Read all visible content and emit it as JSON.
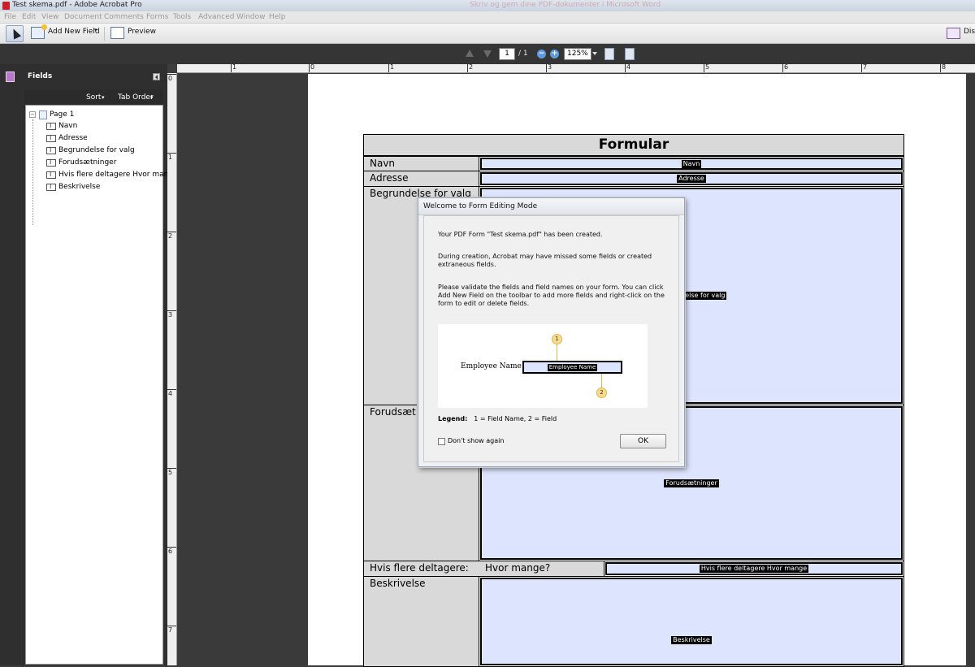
{
  "window": {
    "title": "Test skema.pdf - Adobe Acrobat Pro",
    "ghost_title": "Skriv og gem dine PDF-dokumenter i Microsoft Word"
  },
  "menu": [
    "File",
    "Edit",
    "View",
    "Document",
    "Comments",
    "Forms",
    "Tools",
    "Advanced",
    "Window",
    "Help"
  ],
  "toolbar": {
    "add_new_field": "Add New Field",
    "preview": "Preview",
    "distribute": "Dist"
  },
  "nav": {
    "page": "1",
    "total": "/ 1",
    "zoom": "125%"
  },
  "fields_panel": {
    "title": "Fields",
    "sort_label": "Sort",
    "tab_order_label": "Tab Order",
    "page_label": "Page 1",
    "items": [
      "Navn",
      "Adresse",
      "Begrundelse for valg",
      "Forudsætninger",
      "Hvis flere deltagere Hvor mange",
      "Beskrivelse"
    ]
  },
  "ruler": {
    "top": [
      "1",
      "0",
      "1",
      "2",
      "3",
      "4",
      "5",
      "6",
      "7",
      "8"
    ],
    "left": [
      "0",
      "1",
      "2",
      "3",
      "4",
      "5",
      "6",
      "7"
    ]
  },
  "form": {
    "title": "Formular",
    "rows": {
      "navn": {
        "label": "Navn",
        "field": "Navn"
      },
      "adresse": {
        "label": "Adresse",
        "field": "Adresse"
      },
      "begrundelse": {
        "label": "Begrundelse for valg",
        "field": "lelse for valg"
      },
      "forudsaet": {
        "label": "Forudsæt",
        "field": "Forudsætninger"
      },
      "hvis": {
        "label": "Hvis flere deltagere:",
        "sublabel": "Hvor mange?",
        "field": "Hvis flere deltagere Hvor mange"
      },
      "beskrivelse": {
        "label": "Beskrivelse",
        "field": "Beskrivelse"
      }
    }
  },
  "dialog": {
    "title": "Welcome to Form Editing Mode",
    "p1": "Your PDF Form \"Test skema.pdf\" has been created.",
    "p2": "During creation, Acrobat may have missed some fields or created extraneous fields.",
    "p3": "Please validate the fields and field names on your form. You can click Add New Field on the toolbar to add more fields and right-click on the form to edit or delete fields.",
    "illustration": {
      "label": "Employee Name:",
      "field_name": "Employee Name",
      "marker_1": "1",
      "marker_2": "2"
    },
    "legend_label": "Legend:",
    "legend_text": "1 = Field Name, 2 = Field",
    "dont_show": "Don't show again",
    "ok": "OK"
  }
}
